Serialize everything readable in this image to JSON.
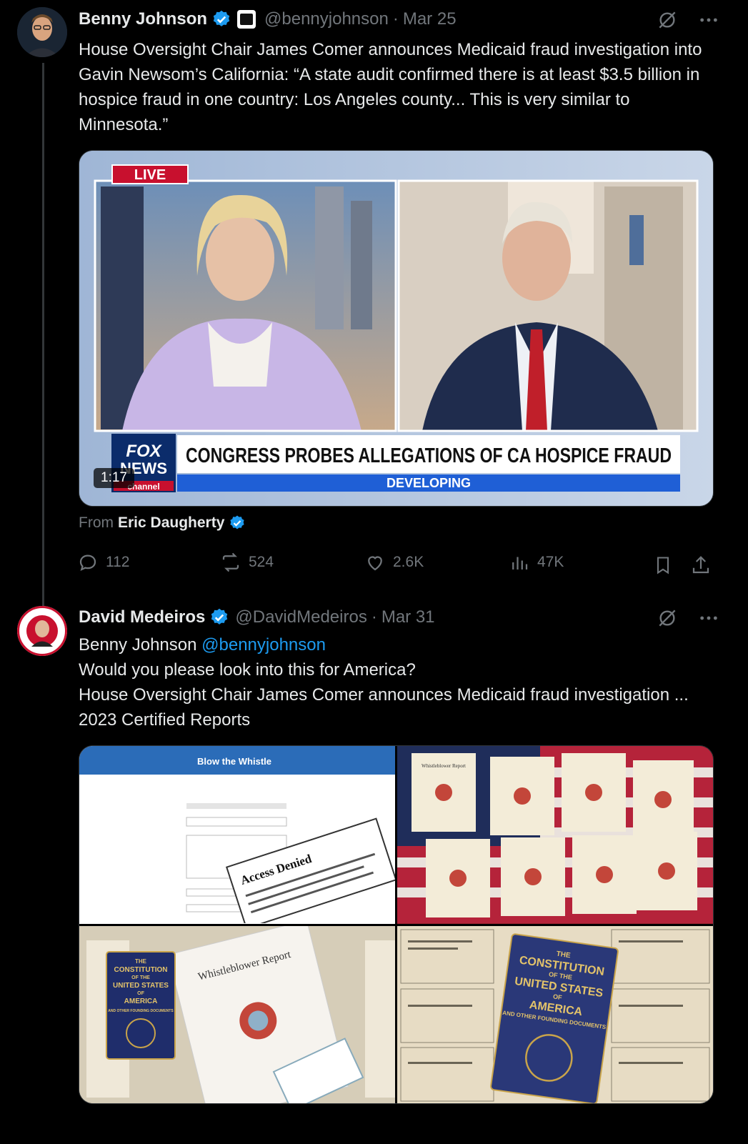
{
  "thread": {
    "tweet1": {
      "author_name": "Benny Johnson",
      "handle": "@bennyjohnson",
      "separator": "·",
      "date": "Mar 25",
      "text": "House Oversight Chair James Comer announces Medicaid fraud investigation into Gavin Newsom’s California: “A state audit confirmed there is at least $3.5 billion in hospice fraud in one country: Los Angeles county... This is very similar to Minnesota.”",
      "video": {
        "live_badge": "LIVE",
        "fox_top": "FOX",
        "fox_mid": "NEWS",
        "fox_bottom": "channel",
        "chyron": "CONGRESS PROBES ALLEGATIONS OF CA HOSPICE FRAUD",
        "sub_chyron": "DEVELOPING",
        "duration": "1:17"
      },
      "from_label": "From",
      "from_name": "Eric Daugherty",
      "stats": {
        "replies": "112",
        "reposts": "524",
        "likes": "2.6K",
        "views": "47K"
      }
    },
    "tweet2": {
      "author_name": "David Medeiros",
      "handle": "@DavidMedeiros",
      "separator": "·",
      "date": "Mar 31",
      "mention_name": "Benny Johnson",
      "mention_handle": "@bennyjohnson",
      "line2": "Would you please look into this for America?",
      "line3": "House Oversight Chair James Comer announces Medicaid fraud investigation ... 2023 Certified Reports",
      "images": {
        "img1_header": "Blow the Whistle",
        "img1_denied": "Access Denied",
        "img2_caption": "Whistleblower Report",
        "img3_title": "Whistleblower Report",
        "img3_book_line1": "THE",
        "img3_book_line2": "CONSTITUTION",
        "img3_book_line3": "OF THE",
        "img3_book_line4": "UNITED STATES",
        "img3_book_line5": "OF",
        "img3_book_line6": "AMERICA",
        "img3_book_line7": "AND OTHER FOUNDING DOCUMENTS"
      }
    }
  },
  "colors": {
    "link": "#1d9bf0",
    "muted": "#71767b",
    "verified": "#1d9bf0"
  }
}
